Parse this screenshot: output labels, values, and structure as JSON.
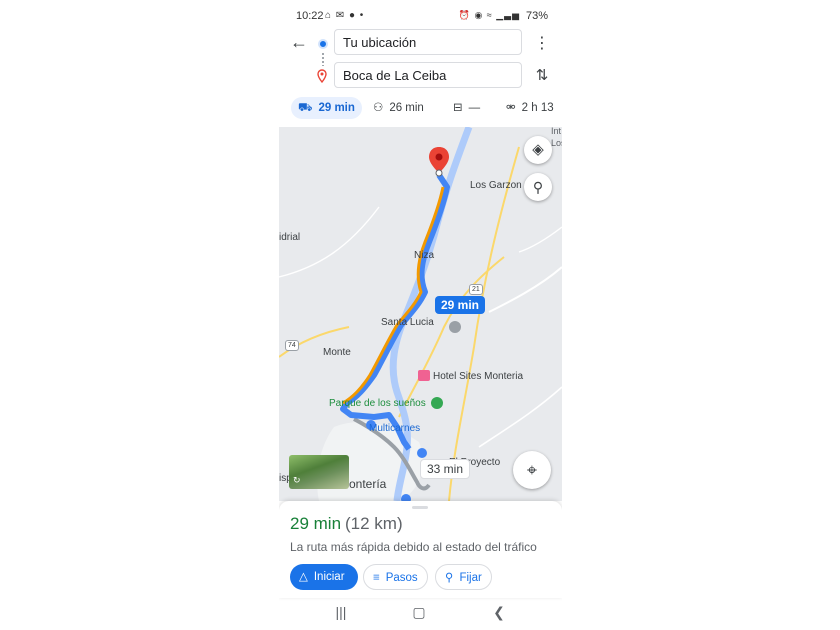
{
  "status_bar": {
    "time": "10:22",
    "left_icons": "⌂ ✉ ● •",
    "right_icons": "⏰ ◉ ≈ ▁▃▅",
    "battery": "73%"
  },
  "directions": {
    "origin": "Tu ubicación",
    "destination": "Boca de La Ceiba"
  },
  "modes": [
    {
      "icon": "car-icon",
      "label": "29 min",
      "glyph": "⛟"
    },
    {
      "icon": "motorcycle-icon",
      "label": "26 min",
      "glyph": "⚇"
    },
    {
      "icon": "transit-icon",
      "label": "—",
      "glyph": "⊟"
    },
    {
      "icon": "walk-icon",
      "label": "2 h 13",
      "glyph": "⸸"
    }
  ],
  "map": {
    "labels": {
      "los_garzon": "Los Garzon",
      "vidrial": "idrial",
      "niza": "Niza",
      "santa_lucia": "Santa Lucia",
      "monte": "Monte",
      "hotel": "Hotel Sites Monteria",
      "parque": "Parque de los sueños",
      "multicarnes": "Multicarnes",
      "proyecto": "El Proyecto",
      "monteria": "Montería",
      "edge_int": "Int",
      "edge_los": "Los",
      "edge_isp": "isp"
    },
    "shields": {
      "r21": "21",
      "r74": "74"
    },
    "route_main_label": "29 min",
    "route_alt_label": "33 min",
    "colors": {
      "route_main": "#4285f4",
      "route_traffic": "#f29900",
      "route_alt": "#9aa0a6",
      "river": "#aecbfa",
      "pin": "#ea4335"
    }
  },
  "summary": {
    "duration": "29 min",
    "distance": "(12 km)",
    "description": "La ruta más rápida debido al estado del tráfico"
  },
  "actions": {
    "start": "Iniciar",
    "steps": "Pasos",
    "pin": "Fijar"
  }
}
